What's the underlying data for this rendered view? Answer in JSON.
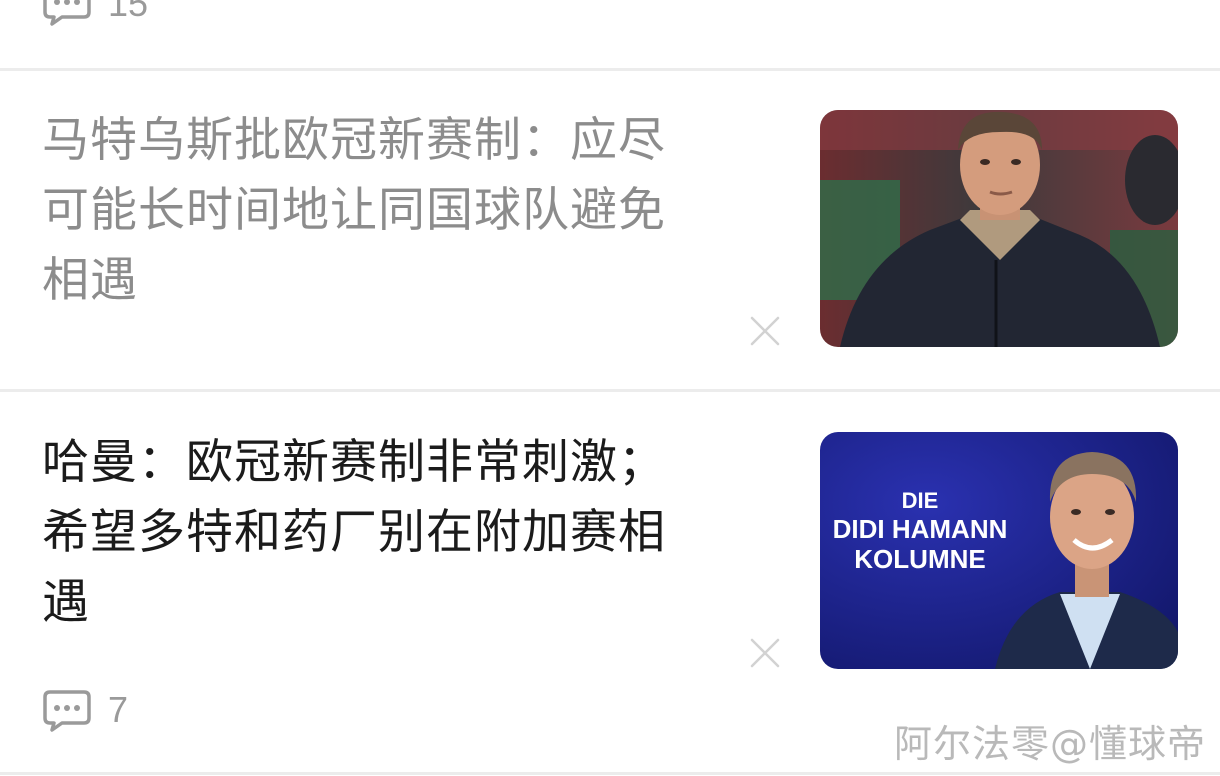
{
  "feed": {
    "top_item": {
      "comment_count": "15",
      "comment_icon": "comment-bubble-icon"
    },
    "articles": [
      {
        "title": "马特乌斯批欧冠新赛制：应尽可能长时间地让同国球队避免相遇",
        "title_lines": [
          "马特乌斯批欧冠新赛制：应尽",
          "可能长时间地让同国球队避免",
          "相遇"
        ],
        "read": true,
        "dismiss_icon": "close-icon",
        "thumbnail": "photo of man in dark puffer jacket at stadium"
      },
      {
        "title": "哈曼：欧冠新赛制非常刺激；希望多特和药厂别在附加赛相遇",
        "title_lines": [
          "哈曼：欧冠新赛制非常刺激；",
          "希望多特和药厂别在附加赛相",
          "遇"
        ],
        "read": false,
        "dismiss_icon": "close-icon",
        "thumbnail_text": [
          "DIE",
          "DIDI HAMANN",
          "KOLUMNE"
        ],
        "comment_count": "7",
        "comment_icon": "comment-bubble-icon"
      }
    ]
  },
  "watermark": "阿尔法零@懂球帝",
  "colors": {
    "read_title": "#8c8c8c",
    "unread_title": "#1b1b1b",
    "meta_gray": "#9a9a9a",
    "divider": "#ececec",
    "thumb_blue": "#1a1f8a"
  }
}
